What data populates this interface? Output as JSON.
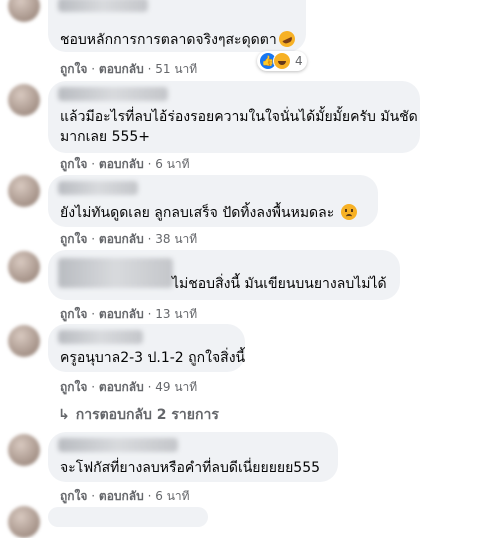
{
  "comments": [
    {
      "text_lines": [
        "ชอบหลักการการตลาดจริงๆสะดุดตา"
      ],
      "emoji": "rofl-emoji",
      "like": "ถูกใจ",
      "reply": "ตอบกลับ",
      "time": "51 นาที",
      "reaction_count": "4"
    },
    {
      "text_lines": [
        "แล้วมีอะไรที่ลบไอ้ร่องรอยความในใจนั่นได้มั้ยมั้ยครับ มันชัด",
        "มากเลย 555+"
      ],
      "like": "ถูกใจ",
      "reply": "ตอบกลับ",
      "time": "6 นาที"
    },
    {
      "text_lines": [
        "ยังไม่ทันดูดเลย ลูกลบเสร็จ ปัดทิ้งลงพื้นหมดละ"
      ],
      "emoji": "sad-emoji",
      "like": "ถูกใจ",
      "reply": "ตอบกลับ",
      "time": "38 นาที"
    },
    {
      "text_lines": [
        "ไม่ชอบสิ่งนี้ มันเขียนบนยางลบไม่ได้"
      ],
      "like": "ถูกใจ",
      "reply": "ตอบกลับ",
      "time": "13 นาที"
    },
    {
      "text_lines": [
        "ครูอนุบาล2-3 ป.1-2 ถูกใจสิ่งนี้"
      ],
      "like": "ถูกใจ",
      "reply": "ตอบกลับ",
      "time": "49 นาที"
    },
    {
      "text_lines": [
        "จะโฟกัสที่ยางลบหรือคำที่ลบดีเนี่ยยยยย555"
      ],
      "like": "ถูกใจ",
      "reply": "ตอบกลับ",
      "time": "6 นาที"
    }
  ],
  "replies_link": "การตอบกลับ 2 รายการ",
  "separator": "·",
  "colors": {
    "bubble": "#f0f2f5",
    "meta": "#65676b",
    "text": "#050505",
    "like_blue": "#1877f2"
  }
}
